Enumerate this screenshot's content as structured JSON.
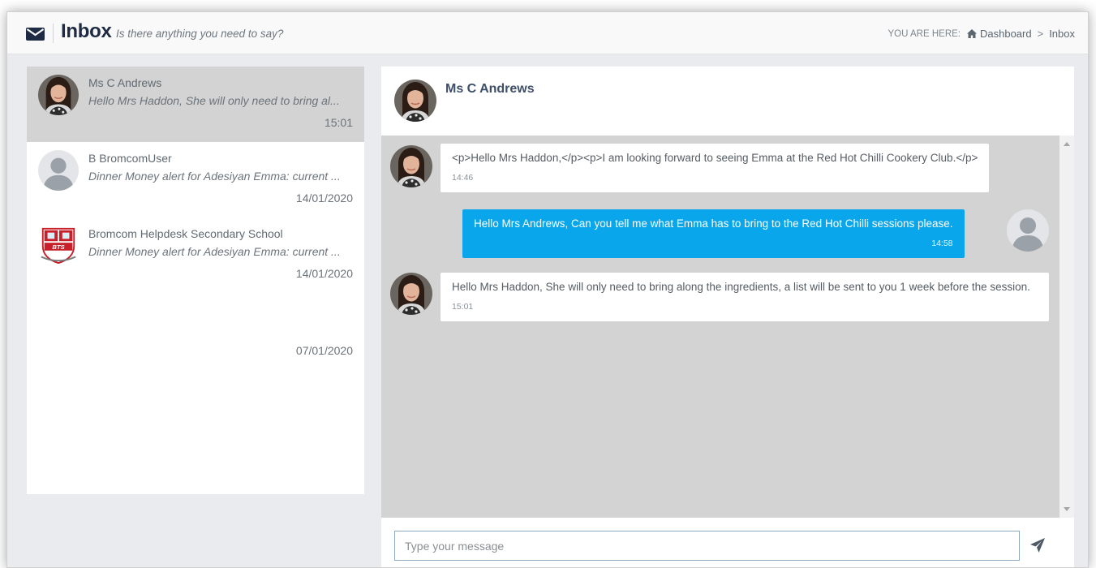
{
  "header": {
    "title": "Inbox",
    "subtitle": "Is there anything you need to say?",
    "breadcrumb_label": "YOU ARE HERE:",
    "breadcrumb_home": "Dashboard",
    "breadcrumb_sep": ">",
    "breadcrumb_current": "Inbox"
  },
  "conversations": [
    {
      "name": "Ms C Andrews",
      "preview": "Hello Mrs Haddon, She will only need to bring al...",
      "time": "15:01"
    },
    {
      "name": "B BromcomUser",
      "preview": "Dinner Money alert for Adesiyan Emma: current ...",
      "time": "14/01/2020"
    },
    {
      "name": "Bromcom Helpdesk Secondary School",
      "preview": "Dinner Money alert for Adesiyan Emma: current ...",
      "time": "14/01/2020",
      "logo_text": "BTS"
    }
  ],
  "orphan_time": "07/01/2020",
  "chat": {
    "contact_name": "Ms C Andrews",
    "messages": [
      {
        "direction": "received",
        "text": "<p>Hello Mrs Haddon,</p><p>I am looking forward to seeing Emma at the Red Hot Chilli Cookery Club.</p>",
        "time": "14:46"
      },
      {
        "direction": "sent",
        "text": "Hello Mrs Andrews, Can you tell me what Emma has to bring to the Red Hot Chilli sessions please.",
        "time": "14:58"
      },
      {
        "direction": "received",
        "text": "Hello Mrs Haddon, She will only need to bring along the ingredients, a list will be sent to you 1 week before the session.",
        "time": "15:01"
      }
    ],
    "input_placeholder": "Type your message",
    "input_value": ""
  },
  "icons": {
    "envelope": "envelope-icon",
    "home": "home-icon",
    "send": "paper-plane-icon"
  },
  "colors": {
    "sent_bubble": "#0aa6ec",
    "active_conversation": "#d3d3d3",
    "chat_background": "#d3d3d3"
  }
}
